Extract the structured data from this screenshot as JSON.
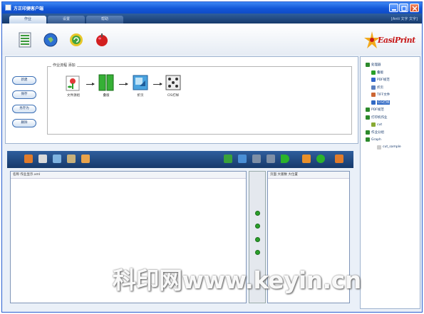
{
  "window": {
    "title": "方正印捷客户端"
  },
  "tabs": [
    {
      "label": "作业"
    },
    {
      "label": "设置"
    },
    {
      "label": "帮助"
    }
  ],
  "tabbar_right": "[Anti 文字 文字]",
  "toolbar": {
    "buttons": [
      {
        "icon": "list-icon"
      },
      {
        "icon": "globe-icon"
      },
      {
        "icon": "refresh-icon"
      },
      {
        "icon": "apple-icon"
      }
    ]
  },
  "logo": {
    "text": "EasiPrint"
  },
  "side_buttons": [
    {
      "label": "新建"
    },
    {
      "label": "保存"
    },
    {
      "label": "另存为"
    },
    {
      "label": "删除"
    }
  ],
  "flow": {
    "label": "作业流程  添加",
    "steps": [
      {
        "label": "文件源组",
        "icon": "flower-document-icon"
      },
      {
        "label": "叠版",
        "icon": "split-pages-icon"
      },
      {
        "label": "折页",
        "icon": "imposition-icon"
      },
      {
        "label": "CIS打样",
        "icon": "proof-icon"
      }
    ]
  },
  "tree": {
    "items": [
      {
        "label": "处理器",
        "level": 0,
        "color": "#2c8a2c"
      },
      {
        "label": "叠版",
        "level": 1,
        "color": "#2aa02a"
      },
      {
        "label": "PDF规范",
        "level": 1,
        "color": "#3366cc"
      },
      {
        "label": "折页",
        "level": 1,
        "color": "#5b7fbf"
      },
      {
        "label": "TIFF文件",
        "level": 1,
        "color": "#cc6633"
      },
      {
        "label": "CIS打样",
        "level": 1,
        "color": "#316ac5",
        "selected": true
      },
      {
        "label": "PDF规范",
        "level": 0,
        "color": "#2c8a2c"
      },
      {
        "label": "打印机作业",
        "level": 0,
        "color": "#2c8a2c"
      },
      {
        "label": "cut",
        "level": 1,
        "color": "#88aa33"
      },
      {
        "label": "作业分组",
        "level": 0,
        "color": "#2c8a2c"
      },
      {
        "label": "Graph",
        "level": 0,
        "color": "#2c8a2c"
      },
      {
        "label": "cut_sample",
        "level": 2,
        "color": "#cccccc"
      }
    ]
  },
  "bottom_toolbar": {
    "left_icons": [
      "open-icon",
      "pen-icon",
      "copy-icon",
      "box-icon",
      "user-icon"
    ],
    "right_icons": [
      "move-icon",
      "green-arrow-icon",
      "arrow-icon",
      "gray-arrow-icon",
      "play-icon",
      "orange-flag-icon",
      "green-circle-icon",
      "orange-box-icon"
    ]
  },
  "left_pane": {
    "header": "名称 作业显示.xml"
  },
  "right_pane": {
    "header": "页面 大版数 大位置"
  },
  "watermark": "科印网www.keyin.cn"
}
